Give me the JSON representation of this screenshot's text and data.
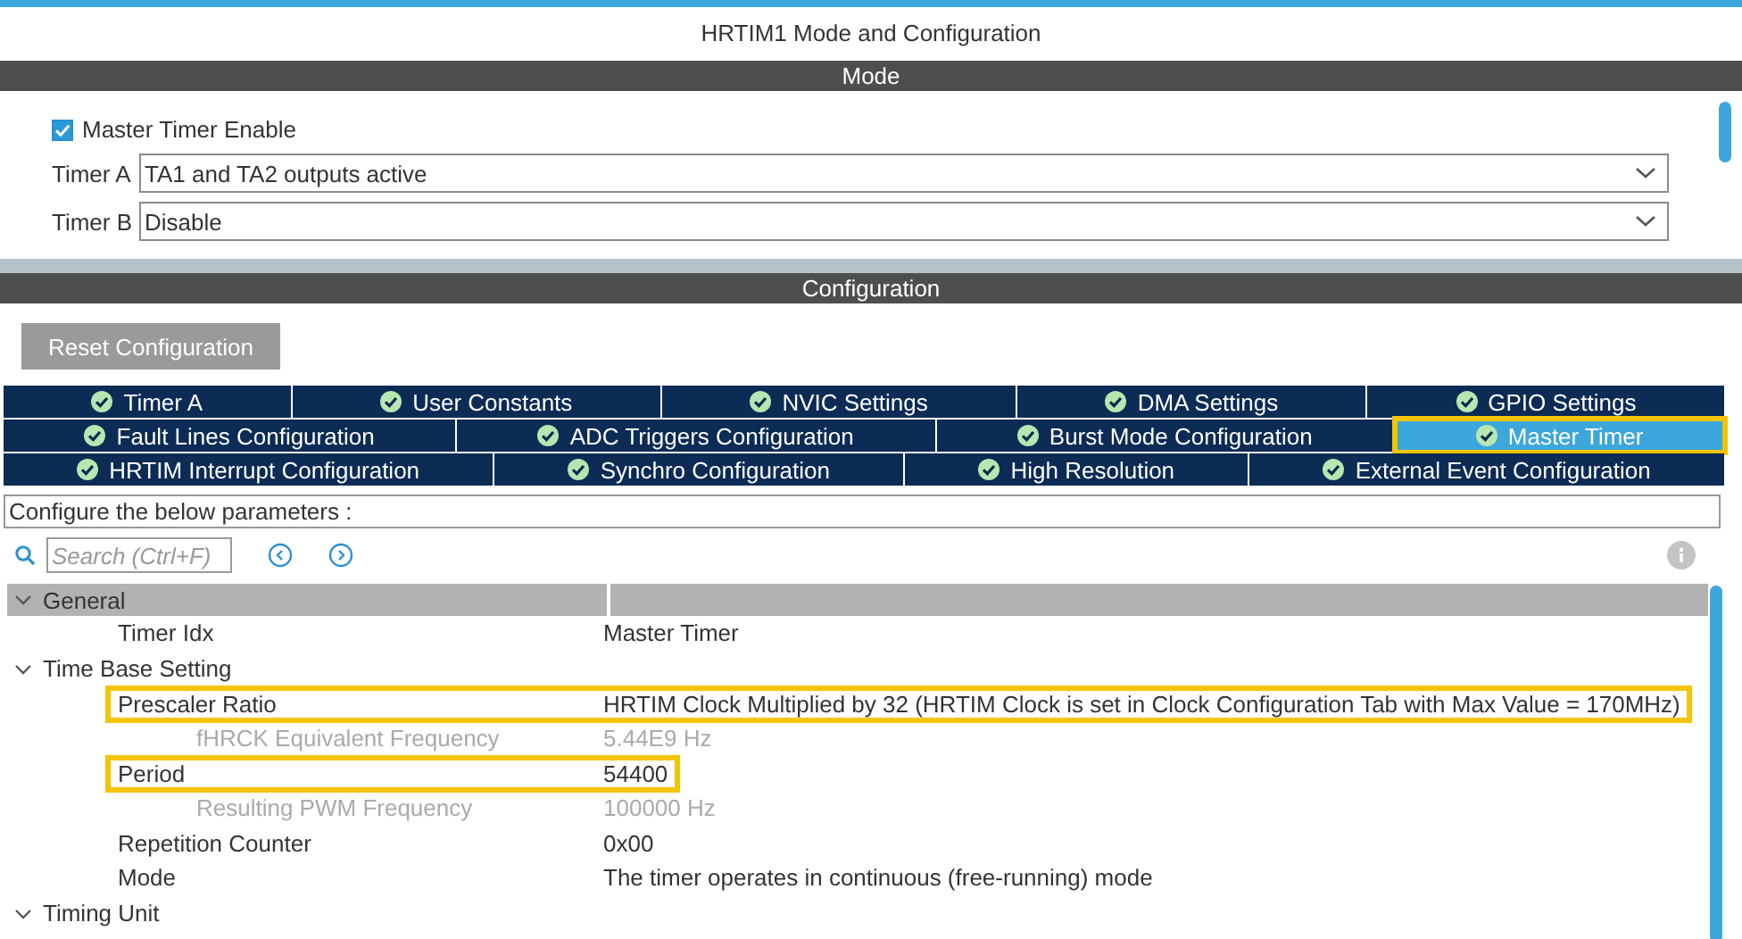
{
  "window": {
    "title": "HRTIM1 Mode and Configuration"
  },
  "mode": {
    "header": "Mode",
    "master_enable": {
      "label": "Master Timer Enable",
      "checked": true
    },
    "fields": [
      {
        "label": "Timer A",
        "value": "TA1 and TA2 outputs active"
      },
      {
        "label": "Timer B",
        "value": "Disable"
      }
    ]
  },
  "configuration": {
    "header": "Configuration",
    "reset_button": "Reset Configuration",
    "tab_rows": [
      [
        {
          "label": "Timer A",
          "selected": false,
          "highlighted": false
        },
        {
          "label": "User Constants",
          "selected": false,
          "highlighted": false
        },
        {
          "label": "NVIC Settings",
          "selected": false,
          "highlighted": false
        },
        {
          "label": "DMA Settings",
          "selected": false,
          "highlighted": false
        },
        {
          "label": "GPIO Settings",
          "selected": false,
          "highlighted": false
        }
      ],
      [
        {
          "label": "Fault Lines Configuration",
          "selected": false,
          "highlighted": false
        },
        {
          "label": "ADC Triggers Configuration",
          "selected": false,
          "highlighted": false
        },
        {
          "label": "Burst Mode Configuration",
          "selected": false,
          "highlighted": false
        },
        {
          "label": "Master Timer",
          "selected": true,
          "highlighted": true
        }
      ],
      [
        {
          "label": "HRTIM Interrupt Configuration",
          "selected": false,
          "highlighted": false
        },
        {
          "label": "Synchro Configuration",
          "selected": false,
          "highlighted": false
        },
        {
          "label": "High Resolution",
          "selected": false,
          "highlighted": false
        },
        {
          "label": "External Event Configuration",
          "selected": false,
          "highlighted": false
        }
      ]
    ],
    "hint": "Configure the below parameters :",
    "search": {
      "placeholder": "Search (Ctrl+F)"
    },
    "tree": [
      {
        "label": "General",
        "expanded": true,
        "header": true,
        "children": [
          {
            "label": "Timer Idx",
            "value": "Master Timer",
            "disabled": false,
            "highlighted": false
          }
        ]
      },
      {
        "label": "Time Base Setting",
        "expanded": true,
        "header": false,
        "children": [
          {
            "label": "Prescaler Ratio",
            "value": "HRTIM Clock Multiplied by 32 (HRTIM Clock is set in Clock Configuration Tab with Max Value = 170MHz)",
            "disabled": false,
            "highlighted": true,
            "children": [
              {
                "label": "fHRCK Equivalent Frequency",
                "value": "5.44E9 Hz",
                "disabled": true,
                "highlighted": false
              }
            ]
          },
          {
            "label": "Period",
            "value": "54400",
            "disabled": false,
            "highlighted": true,
            "children": [
              {
                "label": "Resulting PWM Frequency",
                "value": "100000 Hz",
                "disabled": true,
                "highlighted": false
              }
            ]
          },
          {
            "label": "Repetition Counter",
            "value": "0x00",
            "disabled": false,
            "highlighted": false
          },
          {
            "label": "Mode",
            "value": "The timer operates in continuous (free-running) mode",
            "disabled": false,
            "highlighted": false
          }
        ]
      },
      {
        "label": "Timing Unit",
        "expanded": true,
        "header": false
      }
    ]
  }
}
